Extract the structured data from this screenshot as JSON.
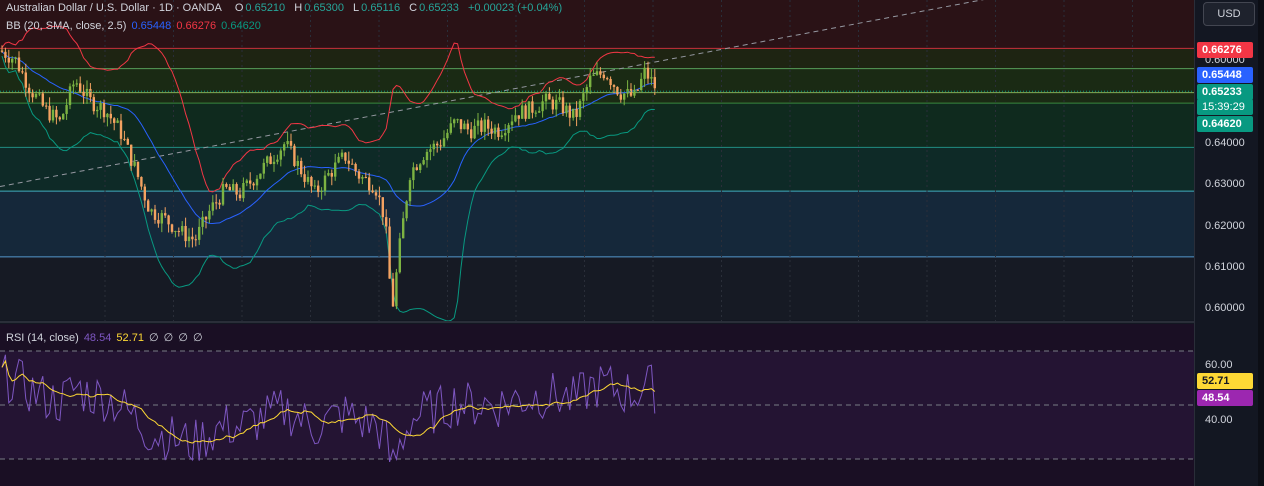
{
  "header": {
    "symbol": "Australian Dollar / U.S. Dollar · 1D · OANDA",
    "o_label": "O",
    "o_value": "0.65210",
    "h_label": "H",
    "h_value": "0.65300",
    "l_label": "L",
    "l_value": "0.65116",
    "c_label": "C",
    "c_value": "0.65233",
    "change": "+0.00023 (+0.04%)"
  },
  "bb_legend": {
    "label": "BB (20, SMA, close, 2.5)",
    "basis": "0.65448",
    "upper": "0.66276",
    "lower": "0.64620"
  },
  "rsi_legend": {
    "label": "RSI (14, close)",
    "rsi": "48.54",
    "ma": "52.71",
    "extras": [
      "∅",
      "∅",
      "∅",
      "∅"
    ]
  },
  "price_axis": {
    "currency_button": "USD",
    "ticks": [
      "0.60000",
      "0.64000",
      "0.63000",
      "0.62000",
      "0.61000",
      "0.60000"
    ],
    "badges": {
      "upper": "0.66276",
      "basis": "0.65448",
      "last": "0.65233",
      "countdown": "15:39:29",
      "lower": "0.64620"
    }
  },
  "rsi_axis": {
    "ticks": [
      "60.00",
      "40.00"
    ],
    "badges": {
      "ma": "52.71",
      "rsi": "48.54"
    }
  },
  "colors": {
    "background": "#131722",
    "up": "#26a69a",
    "down": "#ef5350",
    "bb_upper": "#f23645",
    "bb_basis": "#2962ff",
    "bb_lower": "#089981",
    "rsi": "#7e57c2",
    "rsi_ma": "#fdd835"
  },
  "chart_data": {
    "type": "candlestick",
    "y_range": [
      0.598,
      0.674
    ],
    "horizontal_levels": [
      0.6625,
      0.6577,
      0.652,
      0.6495,
      0.639,
      0.6286,
      0.613
    ],
    "last_price": 0.65233,
    "rsi_levels": [
      70,
      50,
      30
    ],
    "rsi_range": [
      20,
      80
    ]
  }
}
